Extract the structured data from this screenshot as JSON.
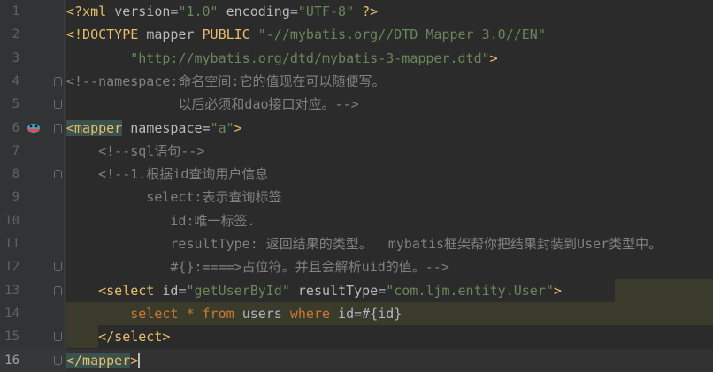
{
  "line_numbers": [
    "1",
    "2",
    "3",
    "4",
    "5",
    "6",
    "7",
    "8",
    "9",
    "10",
    "11",
    "12",
    "13",
    "14",
    "15",
    "16"
  ],
  "lines": {
    "l1": [
      {
        "c": "pun",
        "t": "<?xml "
      },
      {
        "c": "attr",
        "t": "version"
      },
      {
        "c": "plain",
        "t": "="
      },
      {
        "c": "str",
        "t": "\"1.0\""
      },
      {
        "c": "plain",
        "t": " "
      },
      {
        "c": "attr",
        "t": "encoding"
      },
      {
        "c": "plain",
        "t": "="
      },
      {
        "c": "str",
        "t": "\"UTF-8\""
      },
      {
        "c": "plain",
        "t": " "
      },
      {
        "c": "pun",
        "t": "?>"
      }
    ],
    "l2": [
      {
        "c": "tag",
        "t": "<!DOCTYPE "
      },
      {
        "c": "attr",
        "t": "mapper "
      },
      {
        "c": "tag",
        "t": "PUBLIC "
      },
      {
        "c": "str",
        "t": "\"-//mybatis.org//DTD Mapper 3.0//EN\""
      }
    ],
    "l3": [
      {
        "c": "plain",
        "t": "        "
      },
      {
        "c": "str",
        "t": "\"http://mybatis.org/dtd/mybatis-3-mapper.dtd\""
      },
      {
        "c": "tag",
        "t": ">"
      }
    ],
    "l4": [
      {
        "c": "com",
        "t": "<!--namespace:命名空间:它的值现在可以随便写。"
      }
    ],
    "l5": [
      {
        "c": "com",
        "t": "              以后必须和dao接口对应。-->"
      }
    ],
    "l6": [
      {
        "c": "tag tagbg",
        "t": "<mapper"
      },
      {
        "c": "plain",
        "t": " "
      },
      {
        "c": "attr",
        "t": "namespace"
      },
      {
        "c": "plain",
        "t": "="
      },
      {
        "c": "str",
        "t": "\"a\""
      },
      {
        "c": "tag",
        "t": ">"
      }
    ],
    "l7": [
      {
        "c": "plain",
        "t": "    "
      },
      {
        "c": "com",
        "t": "<!--sql语句-->"
      }
    ],
    "l8": [
      {
        "c": "plain",
        "t": "    "
      },
      {
        "c": "com",
        "t": "<!--1.根据id查询用户信息"
      }
    ],
    "l9": [
      {
        "c": "com",
        "t": "          select:表示查询标签"
      }
    ],
    "l10": [
      {
        "c": "com",
        "t": "             id:唯一标签."
      }
    ],
    "l11": [
      {
        "c": "com",
        "t": "             resultType: 返回结果的类型。  mybatis框架帮你把结果封装到User类型中。"
      }
    ],
    "l12": [
      {
        "c": "com",
        "t": "             #{}:====>占位符。并且会解析uid的值。-->"
      }
    ],
    "l13": [
      {
        "c": "plain",
        "t": "    "
      },
      {
        "c": "tag",
        "t": "<select "
      },
      {
        "c": "attr",
        "t": "id"
      },
      {
        "c": "plain",
        "t": "="
      },
      {
        "c": "str",
        "t": "\"getUserById\""
      },
      {
        "c": "plain",
        "t": " "
      },
      {
        "c": "attr",
        "t": "resultType"
      },
      {
        "c": "plain",
        "t": "="
      },
      {
        "c": "str",
        "t": "\"com.ljm.entity.User\""
      },
      {
        "c": "tag",
        "t": ">"
      }
    ],
    "l14": [
      {
        "c": "plain",
        "t": "        "
      },
      {
        "c": "kw",
        "t": "select "
      },
      {
        "c": "kw",
        "t": "* "
      },
      {
        "c": "kw",
        "t": "from "
      },
      {
        "c": "plain",
        "t": "users "
      },
      {
        "c": "kw",
        "t": "where "
      },
      {
        "c": "plain",
        "t": "id=#{id}"
      }
    ],
    "l15": [
      {
        "c": "plain",
        "t": "    "
      },
      {
        "c": "tag",
        "t": "</select>"
      }
    ],
    "l16": [
      {
        "c": "tag tagbg",
        "t": "</mapper"
      },
      {
        "c": "tag",
        "t": ">"
      }
    ]
  },
  "colors": {
    "background": "#2b2b2b",
    "gutter": "#313335",
    "tag": "#e8bf6a",
    "string": "#6a8759",
    "comment": "#808080",
    "keyword": "#cc7832",
    "text": "#a9b7c6"
  },
  "icons": {
    "gutter_bean": "mybatis-bean-icon"
  }
}
